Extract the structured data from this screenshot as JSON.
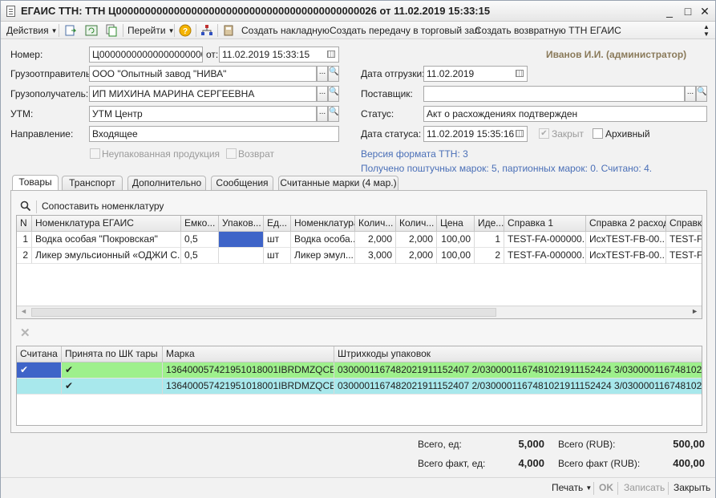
{
  "window": {
    "title": "ЕГАИС ТТН: ТТН Ц000000000000000000000000000000000000000000026 от 11.02.2019 15:33:15",
    "minimize": "_",
    "maximize": "□",
    "close": "✕"
  },
  "toolbar": {
    "actions": "Действия",
    "goto": "Перейти",
    "help": "?",
    "create_invoice": "Создать накладную",
    "create_transfer": "Создать передачу в торговый зал",
    "create_return": "Создать возвратную ТТН ЕГАИС"
  },
  "user": "Иванов И.И. (администратор)",
  "form": {
    "number_label": "Номер:",
    "number_value": "Ц000000000000000000000000000000000000000000026",
    "from_label": "от:",
    "from_value": "11.02.2019 15:33:15",
    "shipper_label": "Грузоотправитель:",
    "shipper_value": "ООО \"Опытный завод \"НИВА\"",
    "consignee_label": "Грузополучатель:",
    "consignee_value": "ИП МИХИНА МАРИНА СЕРГЕЕВНА",
    "utm_label": "УТМ:",
    "utm_value": "УТМ Центр",
    "direction_label": "Направление:",
    "direction_value": "Входящее",
    "unpacked_label": "Неупакованная продукция",
    "return_label": "Возврат",
    "ship_date_label": "Дата отгрузки:",
    "ship_date_value": "11.02.2019",
    "supplier_label": "Поставщик:",
    "supplier_value": "",
    "status_label": "Статус:",
    "status_value": "Акт о расхождениях подтвержден",
    "status_date_label": "Дата статуса:",
    "status_date_value": "11.02.2019 15:35:16",
    "closed_label": "Закрыт",
    "archived_label": "Архивный",
    "format_version": "Версия формата ТТН: 3",
    "marks_info": "Получено поштучных марок: 5, партионных марок: 0. Считано: 4."
  },
  "tabs": [
    "Товары",
    "Транспорт",
    "Дополнительно",
    "Сообщения",
    "Считанные марки (4 мар.)"
  ],
  "goods": {
    "match_label": "Сопоставить номенклатуру",
    "headers": [
      "N",
      "Номенклатура ЕГАИС",
      "Емко...",
      "Упаков...",
      "Ед...",
      "Номенклатура",
      "Колич...",
      "Колич...",
      "Цена",
      "Иде...",
      "Справка 1",
      "Справка 2 расход",
      "Справка"
    ],
    "rows": [
      [
        "1",
        "Водка особая \"Покровская\"",
        "0,5",
        "",
        "шт",
        "Водка особа...",
        "2,000",
        "2,000",
        "100,00",
        "1",
        "TEST-FA-000000...",
        "ИсхTEST-FB-00...",
        "TEST-F"
      ],
      [
        "2",
        "Ликер эмульсионный «ОДЖИ С...",
        "0,5",
        "",
        "шт",
        "Ликер эмул...",
        "3,000",
        "2,000",
        "100,00",
        "2",
        "TEST-FA-000000...",
        "ИсхTEST-FB-00...",
        "TEST-F"
      ]
    ]
  },
  "marks": {
    "headers": [
      "Считана",
      "Принята по ШК тары",
      "Марка",
      "Штрихкоды упаковок"
    ],
    "rows": [
      [
        "✔",
        "✔",
        "136400057421951018001IBRDMZQCE7...",
        "0300001167482021911152407 2/0300001167481021911152424 3/030000116748102191 1..."
      ],
      [
        "",
        "✔",
        "136400057421951018001IBRDMZQCE7...",
        "0300001167482021911152407 2/0300001167481021911152424 3/030000116748102191 1..."
      ]
    ]
  },
  "totals": {
    "total_label": "Всего, ед:",
    "total_value": "5,000",
    "total_rub_label": "Всего (RUB):",
    "total_rub_value": "500,00",
    "fact_label": "Всего факт, ед:",
    "fact_value": "4,000",
    "fact_rub_label": "Всего факт (RUB):",
    "fact_rub_value": "400,00"
  },
  "footer": {
    "print": "Печать",
    "ok": "OK",
    "save": "Записать",
    "close": "Закрыть"
  }
}
